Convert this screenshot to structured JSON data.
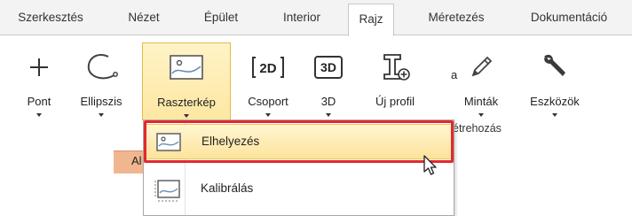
{
  "tabs": [
    {
      "label": "Szerkesztés",
      "active": false
    },
    {
      "label": "Nézet",
      "active": false
    },
    {
      "label": "Épület",
      "active": false
    },
    {
      "label": "Interior",
      "active": false
    },
    {
      "label": "Rajz",
      "active": true
    },
    {
      "label": "Méretezés",
      "active": false
    },
    {
      "label": "Dokumentáció",
      "active": false
    }
  ],
  "ribbon": {
    "buttons": [
      {
        "label": "Pont",
        "icon": "plus-icon",
        "has_dropdown": true
      },
      {
        "label": "Ellipszis",
        "icon": "ellipse-arc-icon",
        "has_dropdown": true
      },
      {
        "label": "Raszterkép",
        "icon": "raster-image-icon",
        "has_dropdown": true,
        "highlighted": true
      },
      {
        "label": "Csoport",
        "icon": "2d-group-icon",
        "icon_text": "2D",
        "has_dropdown": true
      },
      {
        "label": "3D",
        "icon": "3d-icon",
        "icon_text": "3D",
        "has_dropdown": true
      },
      {
        "label": "Új profil",
        "icon": "new-profile-icon",
        "has_dropdown": false
      },
      {
        "label": "Minták",
        "icon": "pencil-icon",
        "has_dropdown": true
      },
      {
        "label": "Eszközök",
        "icon": "wrench-icon",
        "has_dropdown": true
      }
    ],
    "group_label_fragment": "étrehozás",
    "partial_text": "a"
  },
  "document_tab": {
    "label_fragment": "Al"
  },
  "dropdown": {
    "items": [
      {
        "label": "Elhelyezés",
        "icon": "place-image-icon",
        "hovered": true
      },
      {
        "label": "Kalibrálás",
        "icon": "calibrate-image-icon",
        "hovered": false
      }
    ]
  },
  "colors": {
    "highlight": "#fde7a2",
    "highlight_border": "#e6b84a",
    "annotation_red": "#e3282e",
    "document_tab": "#f1b690"
  }
}
